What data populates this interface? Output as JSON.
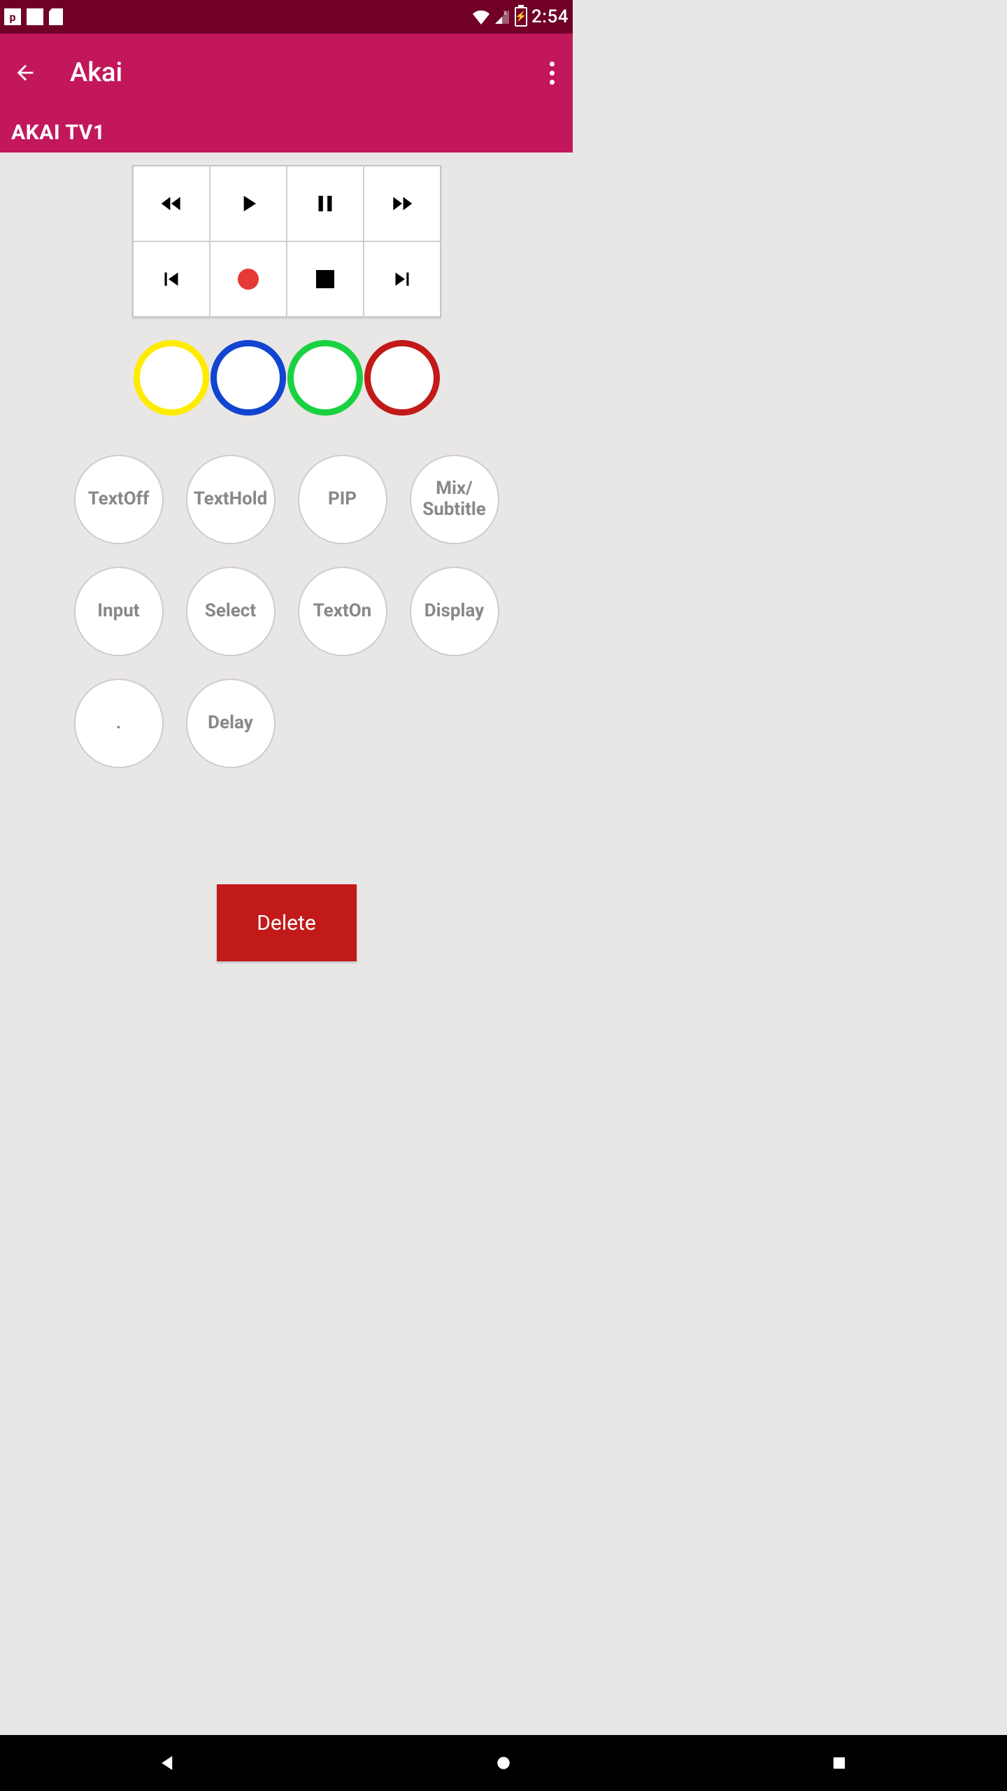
{
  "status": {
    "time": "2:54"
  },
  "appbar": {
    "title": "Akai"
  },
  "tab": {
    "label": "AKAI TV1"
  },
  "colors": {
    "yellow": "#ffeb00",
    "blue": "#1145d1",
    "green": "#19d240",
    "red": "#c21919"
  },
  "buttons": {
    "row1": [
      "TextOff",
      "TextHold",
      "PIP",
      "Mix/\nSubtitle"
    ],
    "row2": [
      "Input",
      "Select",
      "TextOn",
      "Display"
    ],
    "row3": [
      ".",
      "Delay"
    ]
  },
  "delete_label": "Delete"
}
